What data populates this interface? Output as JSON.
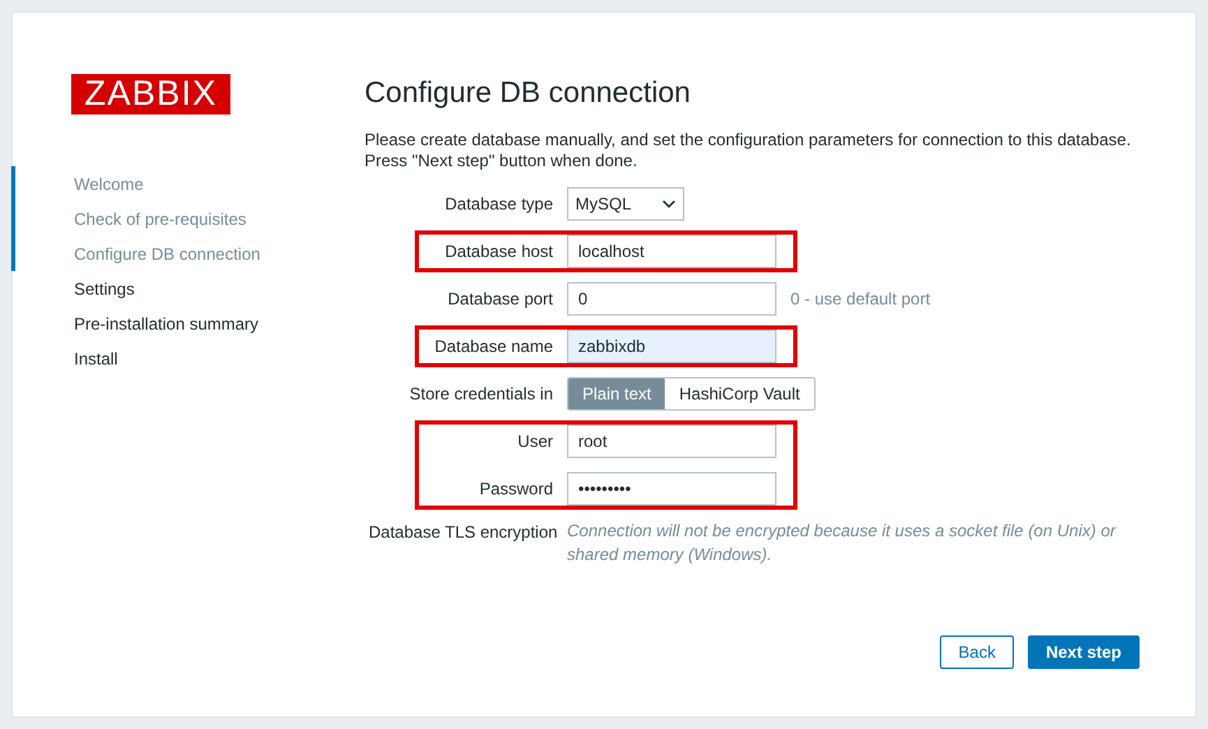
{
  "logo": "ZABBIX",
  "steps": [
    {
      "label": "Welcome",
      "done": true
    },
    {
      "label": "Check of pre-requisites",
      "done": true
    },
    {
      "label": "Configure DB connection",
      "done": true
    },
    {
      "label": "Settings",
      "done": false
    },
    {
      "label": "Pre-installation summary",
      "done": false
    },
    {
      "label": "Install",
      "done": false
    }
  ],
  "title": "Configure DB connection",
  "intro": [
    "Please create database manually, and set the configuration parameters for connection to this database.",
    "Press \"Next step\" button when done."
  ],
  "groups": [
    {
      "highlighted": false,
      "rows": [
        {
          "kind": "select",
          "label": "Database type",
          "value": "MySQL"
        }
      ]
    },
    {
      "highlighted": true,
      "rows": [
        {
          "kind": "input",
          "label": "Database host",
          "value": "localhost",
          "focused": false
        }
      ]
    },
    {
      "highlighted": false,
      "rows": [
        {
          "kind": "input",
          "label": "Database port",
          "value": "0",
          "focused": false,
          "hint": "0 - use default port"
        }
      ]
    },
    {
      "highlighted": true,
      "rows": [
        {
          "kind": "input",
          "label": "Database name",
          "value": "zabbixdb",
          "focused": true
        }
      ]
    },
    {
      "highlighted": false,
      "rows": [
        {
          "kind": "toggle",
          "label": "Store credentials in",
          "options": [
            {
              "label": "Plain text",
              "selected": true
            },
            {
              "label": "HashiCorp Vault",
              "selected": false
            }
          ]
        }
      ]
    },
    {
      "highlighted": true,
      "rows": [
        {
          "kind": "input",
          "label": "User",
          "value": "root",
          "focused": false
        },
        {
          "kind": "password",
          "label": "Password",
          "value": "•••••••••",
          "focused": false
        }
      ]
    },
    {
      "highlighted": false,
      "rows": [
        {
          "kind": "note",
          "label": "Database TLS encryption",
          "text": "Connection will not be encrypted because it uses a socket file (on Unix) or shared memory (Windows)."
        }
      ]
    }
  ],
  "buttons": [
    {
      "label": "Back",
      "primary": false
    },
    {
      "label": "Next step",
      "primary": true
    }
  ]
}
